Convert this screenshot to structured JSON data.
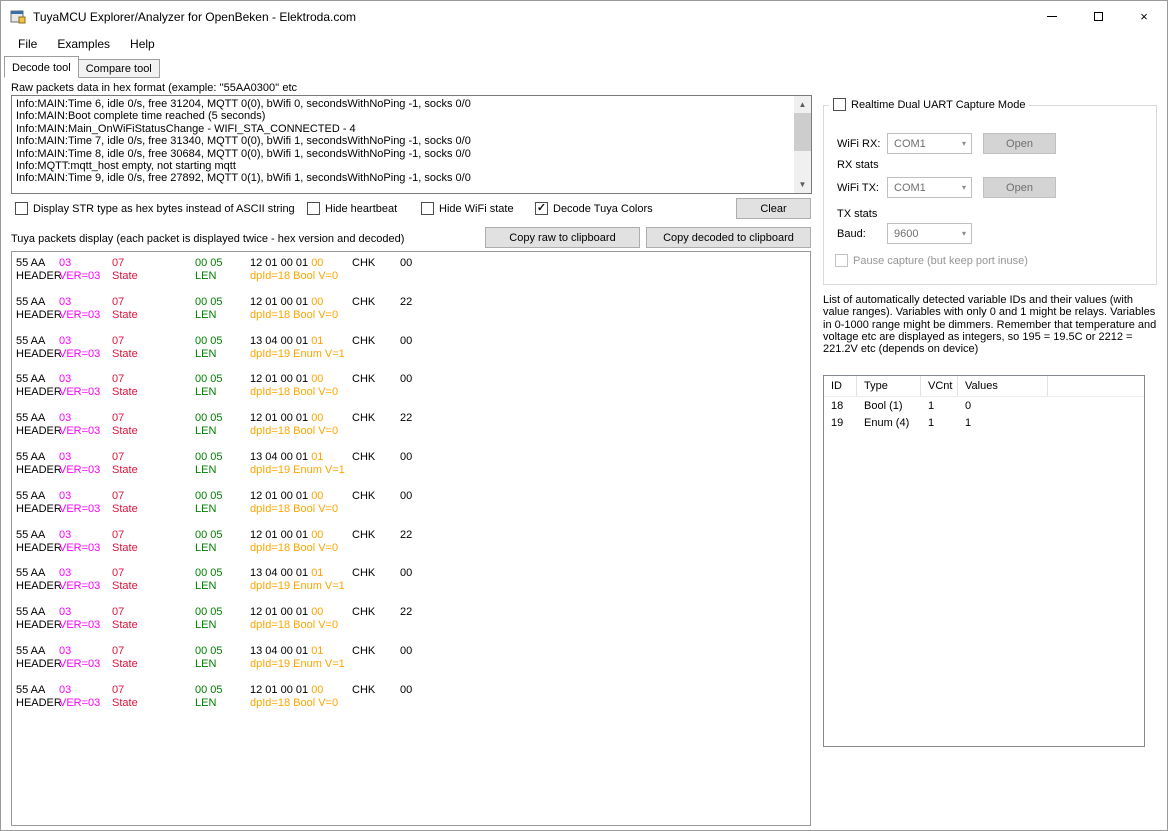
{
  "window": {
    "title": "TuyaMCU Explorer/Analyzer for OpenBeken - Elektroda.com"
  },
  "icons": {
    "close": "×",
    "minimize": "—",
    "maximize": "□",
    "check": "✓",
    "combo_arrow": "▾",
    "scroll_up": "▲",
    "scroll_down": "▼"
  },
  "menu": {
    "items": [
      "File",
      "Examples",
      "Help"
    ]
  },
  "tabs": [
    {
      "label": "Decode tool",
      "active": true
    },
    {
      "label": "Compare tool",
      "active": false
    }
  ],
  "labels": {
    "raw": "Raw packets data in hex format (example: ''55AA0300'' etc",
    "packets": "Tuya packets display (each packet is displayed twice - hex version and decoded)"
  },
  "log_lines": [
    "Info:MAIN:Time 6, idle 0/s, free 31204, MQTT 0(0), bWifi 0, secondsWithNoPing -1, socks 0/0",
    "Info:MAIN:Boot complete time reached (5 seconds)",
    "Info:MAIN:Main_OnWiFiStatusChange - WIFI_STA_CONNECTED - 4",
    "Info:MAIN:Time 7, idle 0/s, free 31340, MQTT 0(0), bWifi 1, secondsWithNoPing -1, socks 0/0",
    "Info:MAIN:Time 8, idle 0/s, free 30684, MQTT 0(0), bWifi 1, secondsWithNoPing -1, socks 0/0",
    "Info:MQTT:mqtt_host empty, not starting mqtt",
    "Info:MAIN:Time 9, idle 0/s, free 27892, MQTT 0(1), bWifi 1, secondsWithNoPing -1, socks 0/0"
  ],
  "options": {
    "checkboxes": [
      {
        "label": "Display STR type as hex bytes instead of ASCII string",
        "checked": false
      },
      {
        "label": "Hide heartbeat",
        "checked": false
      },
      {
        "label": "Hide WiFi state",
        "checked": false
      },
      {
        "label": "Decode Tuya Colors",
        "checked": true
      }
    ]
  },
  "buttons": {
    "clear": "Clear",
    "copy_raw": "Copy raw to clipboard",
    "copy_decoded": "Copy decoded to clipboard"
  },
  "colors": {
    "version": "#ff00ff",
    "command": "#dc143c",
    "length": "#008000",
    "value": "#ffa500",
    "bytes": "#000000"
  },
  "packets": [
    {
      "header_hex": "55 AA",
      "header_label": "HEADER",
      "ver_hex": "03",
      "ver_label": "VER=03",
      "cmd_hex": "07",
      "cmd_label": "State",
      "len_hex": "00 05",
      "len_label": "LEN",
      "payload_hex": "12 01 00 01",
      "value_hex": "00",
      "decoded": "dpId=18 Bool V=0",
      "chk_label": "CHK",
      "chk_hex": "00"
    },
    {
      "header_hex": "55 AA",
      "header_label": "HEADER",
      "ver_hex": "03",
      "ver_label": "VER=03",
      "cmd_hex": "07",
      "cmd_label": "State",
      "len_hex": "00 05",
      "len_label": "LEN",
      "payload_hex": "12 01 00 01",
      "value_hex": "00",
      "decoded": "dpId=18 Bool V=0",
      "chk_label": "CHK",
      "chk_hex": "22"
    },
    {
      "header_hex": "55 AA",
      "header_label": "HEADER",
      "ver_hex": "03",
      "ver_label": "VER=03",
      "cmd_hex": "07",
      "cmd_label": "State",
      "len_hex": "00 05",
      "len_label": "LEN",
      "payload_hex": "13 04 00 01",
      "value_hex": "01",
      "decoded": "dpId=19 Enum V=1",
      "chk_label": "CHK",
      "chk_hex": "00"
    },
    {
      "header_hex": "55 AA",
      "header_label": "HEADER",
      "ver_hex": "03",
      "ver_label": "VER=03",
      "cmd_hex": "07",
      "cmd_label": "State",
      "len_hex": "00 05",
      "len_label": "LEN",
      "payload_hex": "12 01 00 01",
      "value_hex": "00",
      "decoded": "dpId=18 Bool V=0",
      "chk_label": "CHK",
      "chk_hex": "00"
    },
    {
      "header_hex": "55 AA",
      "header_label": "HEADER",
      "ver_hex": "03",
      "ver_label": "VER=03",
      "cmd_hex": "07",
      "cmd_label": "State",
      "len_hex": "00 05",
      "len_label": "LEN",
      "payload_hex": "12 01 00 01",
      "value_hex": "00",
      "decoded": "dpId=18 Bool V=0",
      "chk_label": "CHK",
      "chk_hex": "22"
    },
    {
      "header_hex": "55 AA",
      "header_label": "HEADER",
      "ver_hex": "03",
      "ver_label": "VER=03",
      "cmd_hex": "07",
      "cmd_label": "State",
      "len_hex": "00 05",
      "len_label": "LEN",
      "payload_hex": "13 04 00 01",
      "value_hex": "01",
      "decoded": "dpId=19 Enum V=1",
      "chk_label": "CHK",
      "chk_hex": "00"
    },
    {
      "header_hex": "55 AA",
      "header_label": "HEADER",
      "ver_hex": "03",
      "ver_label": "VER=03",
      "cmd_hex": "07",
      "cmd_label": "State",
      "len_hex": "00 05",
      "len_label": "LEN",
      "payload_hex": "12 01 00 01",
      "value_hex": "00",
      "decoded": "dpId=18 Bool V=0",
      "chk_label": "CHK",
      "chk_hex": "00"
    },
    {
      "header_hex": "55 AA",
      "header_label": "HEADER",
      "ver_hex": "03",
      "ver_label": "VER=03",
      "cmd_hex": "07",
      "cmd_label": "State",
      "len_hex": "00 05",
      "len_label": "LEN",
      "payload_hex": "12 01 00 01",
      "value_hex": "00",
      "decoded": "dpId=18 Bool V=0",
      "chk_label": "CHK",
      "chk_hex": "22"
    },
    {
      "header_hex": "55 AA",
      "header_label": "HEADER",
      "ver_hex": "03",
      "ver_label": "VER=03",
      "cmd_hex": "07",
      "cmd_label": "State",
      "len_hex": "00 05",
      "len_label": "LEN",
      "payload_hex": "13 04 00 01",
      "value_hex": "01",
      "decoded": "dpId=19 Enum V=1",
      "chk_label": "CHK",
      "chk_hex": "00"
    },
    {
      "header_hex": "55 AA",
      "header_label": "HEADER",
      "ver_hex": "03",
      "ver_label": "VER=03",
      "cmd_hex": "07",
      "cmd_label": "State",
      "len_hex": "00 05",
      "len_label": "LEN",
      "payload_hex": "12 01 00 01",
      "value_hex": "00",
      "decoded": "dpId=18 Bool V=0",
      "chk_label": "CHK",
      "chk_hex": "22"
    },
    {
      "header_hex": "55 AA",
      "header_label": "HEADER",
      "ver_hex": "03",
      "ver_label": "VER=03",
      "cmd_hex": "07",
      "cmd_label": "State",
      "len_hex": "00 05",
      "len_label": "LEN",
      "payload_hex": "13 04 00 01",
      "value_hex": "01",
      "decoded": "dpId=19 Enum V=1",
      "chk_label": "CHK",
      "chk_hex": "00"
    },
    {
      "header_hex": "55 AA",
      "header_label": "HEADER",
      "ver_hex": "03",
      "ver_label": "VER=03",
      "cmd_hex": "07",
      "cmd_label": "State",
      "len_hex": "00 05",
      "len_label": "LEN",
      "payload_hex": "12 01 00 01",
      "value_hex": "00",
      "decoded": "dpId=18 Bool V=0",
      "chk_label": "CHK",
      "chk_hex": "00"
    }
  ],
  "capture": {
    "title": "Realtime Dual UART Capture Mode",
    "wifi_rx": {
      "label": "WiFi RX:",
      "port": "COM1",
      "open": "Open",
      "stats": "RX stats"
    },
    "wifi_tx": {
      "label": "WiFi TX:",
      "port": "COM1",
      "open": "Open",
      "stats": "TX stats"
    },
    "baud": {
      "label": "Baud:",
      "value": "9600"
    },
    "pause_label": "Pause capture (but keep port inuse)"
  },
  "variables_info": "List of automatically detected variable IDs  and their values (with value ranges). Variables with only 0 and 1 might be relays. Variables in 0-1000 range might be dimmers. Remember that temperature and voltage etc are displayed as integers, so 195 = 19.5C or 2212 = 221.2V etc (depends on device)",
  "variables_table": {
    "columns": [
      "ID",
      "Type",
      "VCnt",
      "Values"
    ],
    "rows": [
      [
        "18",
        "Bool (1)",
        "1",
        "0"
      ],
      [
        "19",
        "Enum (4)",
        "1",
        "1"
      ]
    ]
  }
}
